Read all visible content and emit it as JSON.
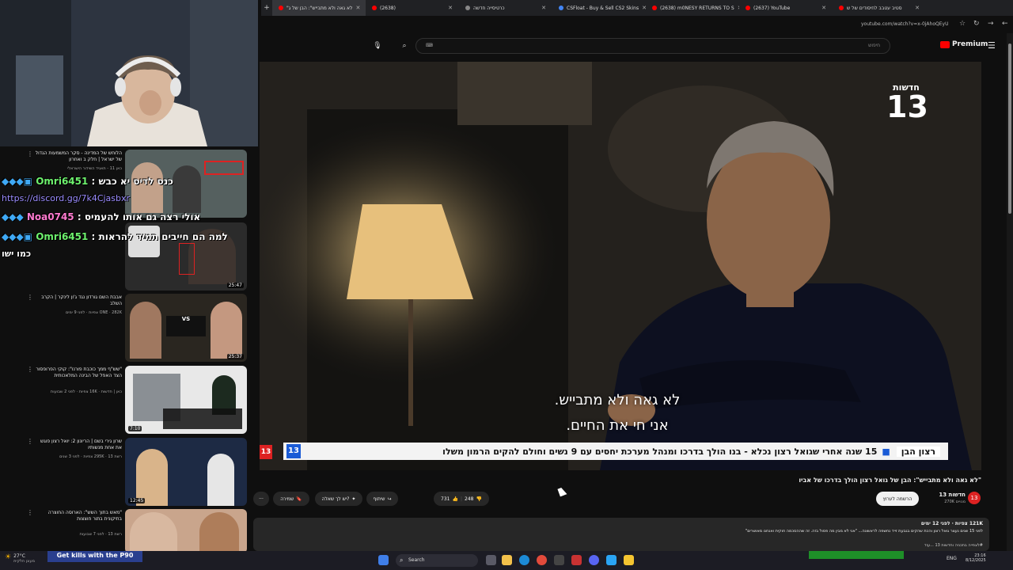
{
  "browser": {
    "tabs": [
      {
        "label": "\"לא גאה ולא מתבייש\": הבן של ג",
        "active": true,
        "color": "#ff0000"
      },
      {
        "label": "(2638)",
        "active": false,
        "color": "#ff0000"
      },
      {
        "label": "כרטיסייה חדשה",
        "active": false,
        "color": "#888888"
      },
      {
        "label": "CSFloat - Buy & Sell CS2 Skins",
        "active": false,
        "color": "#4285f4"
      },
      {
        "label": "(2638) m0NESY RETURNS TO S",
        "active": false,
        "color": "#ff0000"
      },
      {
        "label": "(2637) YouTube",
        "active": false,
        "color": "#ff0000"
      },
      {
        "label": "סטיב עטבב לחיסודים של ש",
        "active": false,
        "color": "#ff0000"
      }
    ],
    "url": "youtube.com/watch?v=x-0jAhoQEyU"
  },
  "youtube": {
    "search_placeholder": "חיפוש",
    "premium_label": "Premium"
  },
  "video": {
    "channel_bug": "חדשות",
    "channel_number": "13",
    "subtitle_line1": "לא גאה ולא מתבייש.",
    "subtitle_line2": "אני חי את החיים.",
    "lower_third_name": "רצון הבן",
    "lower_third_text": "15 שנה אחרי שגואל רצון נכלא - בנו הולך בדרכו ומנהל מערכת יחסים עם 9 נשים וחולם להקים הרמון משלו"
  },
  "meta": {
    "title": "\"לא גאה ולא מתבייש\": הבן של גואל רצון הולך בדרכו של אביו",
    "channel": "חדשות 13",
    "subscribers": "270K מנויים",
    "subscribe_label": "הרשמה לערוץ",
    "likes": "731",
    "dislikes": "248",
    "share_label": "שיתוף",
    "ask_label": "יש לך שאלה?",
    "save_label": "שמירה",
    "more_label": "···",
    "views_time": "121K צפיות · לפני 12 ימים",
    "description": "לפני 15 שנים נעצר גואל רצון והכת שהקים בגבעת זייד נחשפה לראשונה... \"אני לא מבין מה פסול בזה. זה שההסכמה חוקית ואנחנו מאושרים\"",
    "hashtag": "#לצפייה בתכניה וחדשות 13 ...עוד"
  },
  "sidebar": {
    "chat": [
      {
        "user": "Omri6451",
        "text": "כנס לדיס יא כבש",
        "color": "#6ef26e"
      },
      {
        "user": "",
        "text": "https://discord.gg/7k4Cjasbxr",
        "color": "#9b8cff"
      },
      {
        "user": "Noa0745",
        "text": "אולי רצה גם אותו להעמיס",
        "color": "#ff7bd0"
      },
      {
        "user": "Omri6451",
        "text": "למה הם חייבים תמיד להראות",
        "color": "#6ef26e"
      },
      {
        "user": "",
        "text": "כמו ישו",
        "color": "#ffffff"
      }
    ],
    "videos": [
      {
        "title": "הלוחש של המדינה - סקר המשמעות הגדול של ישראל | חלק ב ואחרון",
        "meta": "כאן 11 - תאגיד השידור הישראלי",
        "duration": "",
        "thumb": "#6b7a7a"
      },
      {
        "title": "",
        "meta": "",
        "duration": "25:47",
        "thumb": "#2b2b2b"
      },
      {
        "title": "אבבת השם גורדון נגד ג'ון לינקר | הקרב השלב",
        "meta": "ONE · 282K צפיות · לפני 9 ימים",
        "duration": "25:37",
        "thumb": "#2a2620"
      },
      {
        "title": "\"שש\"ף ממך כוכבת פורנו\": קוקי הפרופסור הצד האפל של הבינה המלאכותית",
        "meta": "כאן | חדשות · 16K צפיות · לפני 2 שבועות",
        "duration": "7:10",
        "thumb": "#e8e8e8"
      },
      {
        "title": "שרון גירי בשם | הריונון 2: יואל רצון פוגש את אחת מנשותיו",
        "meta": "רשת 13 · 295K צפיות · לפני 3 שנים",
        "duration": "12:45",
        "thumb": "#1d2a44"
      },
      {
        "title": "\"מאש בתוך השש\": הארוסה החוצרה בתיקונית בתור חוצצות",
        "meta": "רשת 13 · לפני 7 שבועות",
        "duration": "",
        "thumb": "#c9a58c"
      }
    ]
  },
  "taskbar": {
    "weather": "27°C",
    "weather_sub": "מעונן חלקית",
    "ad_text": "Get kills with the P90",
    "search_label": "Search",
    "lang": "ENG",
    "clock_time": "23:16",
    "clock_date": "8/12/2025"
  }
}
